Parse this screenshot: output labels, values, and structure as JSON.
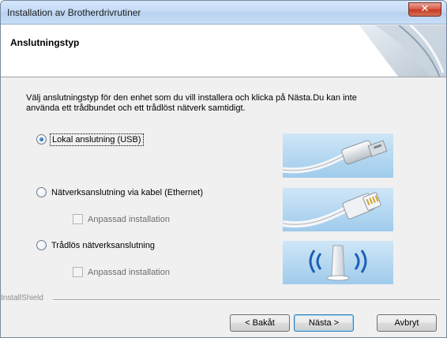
{
  "window": {
    "title": "Installation av Brotherdrivrutiner",
    "close_symbol": "✕"
  },
  "header": {
    "title": "Anslutningstyp"
  },
  "description": "Välj anslutningstyp för den enhet som du vill installera och klicka på Nästa.Du kan inte\nanvända ett trådbundet och ett trådlöst nätverk samtidigt.",
  "options": [
    {
      "label": "Lokal anslutning (USB)",
      "selected": true,
      "icon": "usb-cable-icon"
    },
    {
      "label": "Nätverksanslutning via kabel (Ethernet)",
      "selected": false,
      "icon": "ethernet-cable-icon",
      "sub_option": {
        "label": "Anpassad installation",
        "checked": false,
        "enabled": false
      }
    },
    {
      "label": "Trådlös nätverksanslutning",
      "selected": false,
      "icon": "wireless-router-icon",
      "sub_option": {
        "label": "Anpassad installation",
        "checked": false,
        "enabled": false
      }
    }
  ],
  "footer": {
    "brand": "InstallShield",
    "back_label": "< Bakåt",
    "next_label": "Nästa >",
    "cancel_label": "Avbryt"
  },
  "colors": {
    "accent": "#0b4f9c",
    "close_button": "#c43a1f",
    "image_background": "#b8d9f2"
  }
}
